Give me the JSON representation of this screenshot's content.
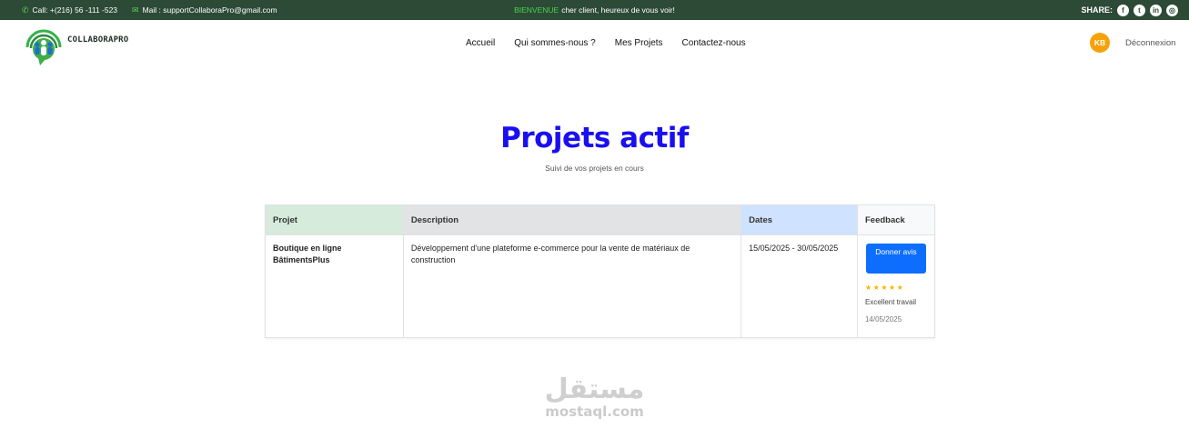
{
  "topbar": {
    "call_label": "Call: +(216) 56 -111 -523",
    "mail_label": "Mail : supportCollaboraPro@gmail.com",
    "welcome_highlight": "BIENVENUE",
    "welcome_text": "cher client, heureux de vous voir!",
    "share_label": "SHARE:",
    "social_icons": [
      "facebook-icon",
      "twitter-icon",
      "linkedin-icon",
      "dribbble-icon"
    ]
  },
  "brand": {
    "name": "COLLABORAPRO"
  },
  "nav": {
    "items": [
      {
        "label": "Accueil"
      },
      {
        "label": "Qui sommes-nous ?"
      },
      {
        "label": "Mes Projets"
      },
      {
        "label": "Contactez-nous"
      }
    ]
  },
  "user": {
    "initials": "KB",
    "logout_label": "Déconnexion"
  },
  "page": {
    "title": "Projets actif",
    "subtitle": "Suivi de vos projets en cours"
  },
  "table": {
    "headers": [
      "Projet",
      "Description",
      "Dates",
      "Feedback"
    ],
    "rows": [
      {
        "project": "Boutique en ligne BâtimentsPlus",
        "description": "Développement d'une plateforme e-commerce pour la vente de matériaux de construction",
        "dates": "15/05/2025 - 30/05/2025",
        "feedback": {
          "button_label": "Donner avis",
          "stars": "★★★★★",
          "rating": 5,
          "comment": "Excellent travail",
          "date": "14/05/2025"
        }
      }
    ]
  },
  "watermark": {
    "arabic": "مستقل",
    "latin": "mostaql.com"
  },
  "colors": {
    "topbar_bg": "#2c4a36",
    "accent_green": "#49d44b",
    "title_blue": "#1a0ff0",
    "button_blue": "#0d6efd",
    "avatar_orange": "#f5a20a",
    "star_yellow": "#f5b400"
  }
}
